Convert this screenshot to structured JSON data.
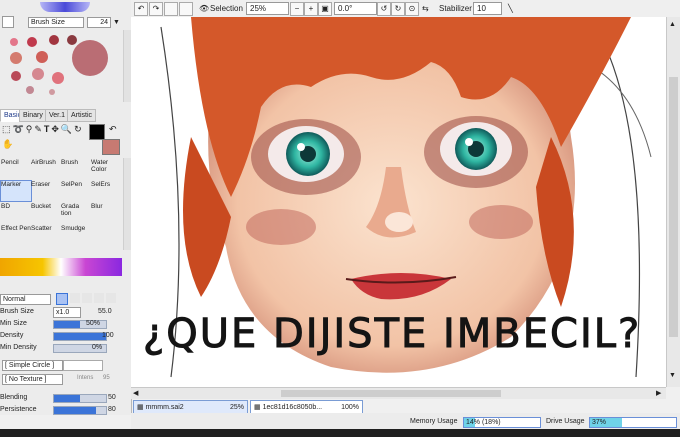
{
  "left_panel": {
    "brush_size_label": "Brush Size",
    "brush_size_value": "24",
    "tabs": [
      "Basic",
      "Binary",
      "Ver.1",
      "Artistic"
    ],
    "active_tab": "Basic",
    "tools": [
      {
        "label": "Pencil",
        "active": false
      },
      {
        "label": "AirBrush",
        "active": false
      },
      {
        "label": "Brush",
        "active": false
      },
      {
        "label": "Water Color",
        "active": false
      },
      {
        "label": "Marker",
        "active": true
      },
      {
        "label": "Eraser",
        "active": false
      },
      {
        "label": "SelPen",
        "active": false
      },
      {
        "label": "SelErs",
        "active": false
      },
      {
        "label": "BD",
        "active": false
      },
      {
        "label": "Bucket",
        "active": false
      },
      {
        "label": "Grada tion",
        "active": false
      },
      {
        "label": "Blur",
        "active": false
      },
      {
        "label": "Effect Pen",
        "active": false
      },
      {
        "label": "Scatter",
        "active": false
      },
      {
        "label": "Smudge",
        "active": false
      }
    ],
    "blend_mode": "Normal",
    "brush_size": {
      "label": "Brush Size",
      "multiplier": "x1.0",
      "value": "55.0"
    },
    "min_size": {
      "label": "Min Size",
      "value": "50%",
      "level": 0.5
    },
    "density": {
      "label": "Density",
      "value": "100",
      "level": 1.0
    },
    "min_density": {
      "label": "Min Density",
      "value": "0%",
      "level": 0.0
    },
    "shape": "[ Simple Circle ]",
    "texture": "[ No Texture ]",
    "texture_intensity_label": "Intens",
    "texture_intensity": "95",
    "blending": {
      "label": "Blending",
      "value": "50",
      "level": 0.5
    },
    "persistence": {
      "label": "Persistence",
      "value": "80",
      "level": 0.8
    }
  },
  "toolbar": {
    "selection_label": "Selection",
    "zoom": "25%",
    "rotation": "0.0°",
    "stabilizer_label": "Stabilizer",
    "stabilizer_value": "10"
  },
  "canvas": {
    "caption": "¿QUE DIJISTE IMBECIL?"
  },
  "files": [
    {
      "name": "mmmm.sai2",
      "zoom": "25%"
    },
    {
      "name": "1ec81d16c8050b...",
      "zoom": "100%"
    }
  ],
  "status": {
    "memory_label": "Memory Usage",
    "memory_value": "14% (18%)",
    "memory_level": 0.14,
    "drive_label": "Drive Usage",
    "drive_value": "37%",
    "drive_level": 0.37
  },
  "colors": {
    "accent": "#3b74d8",
    "hair": "#d4582a",
    "skin": "#f3c7a4",
    "iris": "#2fb6a2"
  }
}
